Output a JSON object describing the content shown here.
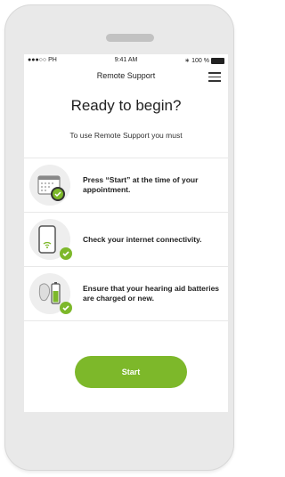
{
  "statusbar": {
    "carrier": "●●●○○ PH",
    "time": "9:41 AM",
    "battery": "100 %"
  },
  "nav": {
    "title": "Remote Support",
    "menu_icon": "hamburger-menu-icon"
  },
  "main": {
    "heading": "Ready to begin?",
    "subheading": "To use Remote Support you must",
    "steps": [
      {
        "text": "Press “Start” at the time of your appointment.",
        "icon": "calendar-clock-icon"
      },
      {
        "text": "Check your internet connectivity.",
        "icon": "phone-wifi-icon"
      },
      {
        "text": "Ensure that your hearing aid batteries are charged or new.",
        "icon": "hearing-aid-battery-icon"
      }
    ],
    "start_label": "Start"
  },
  "colors": {
    "accent": "#7db82a"
  }
}
